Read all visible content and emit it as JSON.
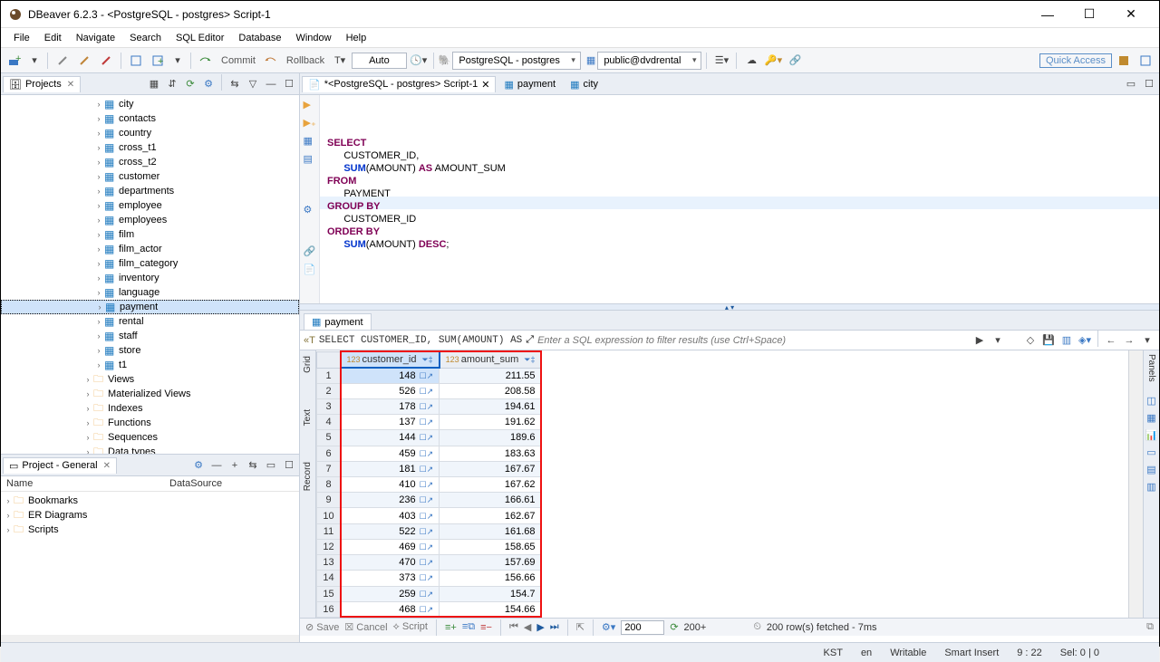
{
  "window": {
    "title": "DBeaver 6.2.3 - <PostgreSQL - postgres> Script-1"
  },
  "menu": [
    "File",
    "Edit",
    "Navigate",
    "Search",
    "SQL Editor",
    "Database",
    "Window",
    "Help"
  ],
  "toolbar": {
    "commit": "Commit",
    "rollback": "Rollback",
    "auto": "Auto",
    "connection": "PostgreSQL - postgres",
    "schema": "public@dvdrental",
    "quick_access": "Quick Access"
  },
  "projects": {
    "tab": "Projects",
    "tables": [
      "city",
      "contacts",
      "country",
      "cross_t1",
      "cross_t2",
      "customer",
      "departments",
      "employee",
      "employees",
      "film",
      "film_actor",
      "film_category",
      "inventory",
      "language",
      "payment",
      "rental",
      "staff",
      "store",
      "t1"
    ],
    "folders": [
      "Views",
      "Materialized Views",
      "Indexes",
      "Functions",
      "Sequences",
      "Data types"
    ],
    "selected": "payment"
  },
  "project_general": {
    "tab": "Project - General",
    "col_name": "Name",
    "col_ds": "DataSource",
    "items": [
      "Bookmarks",
      "ER Diagrams",
      "Scripts"
    ]
  },
  "editor": {
    "tabs": [
      {
        "label": "*<PostgreSQL - postgres> Script-1",
        "active": true
      },
      {
        "label": "payment",
        "active": false
      },
      {
        "label": "city",
        "active": false
      }
    ],
    "sql_lines": [
      {
        "kw": "SELECT",
        "rest": ""
      },
      {
        "kw": "",
        "rest": "      CUSTOMER_ID,"
      },
      {
        "kw": "",
        "rest": "      SUM(AMOUNT) AS AMOUNT_SUM"
      },
      {
        "kw": "FROM",
        "rest": ""
      },
      {
        "kw": "",
        "rest": "      PAYMENT"
      },
      {
        "kw": "GROUP BY",
        "rest": ""
      },
      {
        "kw": "",
        "rest": "      CUSTOMER_ID"
      },
      {
        "kw": "ORDER BY",
        "rest": ""
      },
      {
        "kw": "",
        "rest": "      SUM(AMOUNT) DESC;"
      }
    ]
  },
  "results": {
    "tab": "payment",
    "filter_static": "SELECT CUSTOMER_ID, SUM(AMOUNT) AS",
    "filter_placeholder": "Enter a SQL expression to filter results (use Ctrl+Space)",
    "side_grid": "Grid",
    "side_text": "Text",
    "side_record": "Record",
    "panels_label": "Panels",
    "col1": "customer_id",
    "col2": "amount_sum",
    "rows": [
      {
        "n": 1,
        "c": 148,
        "a": "211.55"
      },
      {
        "n": 2,
        "c": 526,
        "a": "208.58"
      },
      {
        "n": 3,
        "c": 178,
        "a": "194.61"
      },
      {
        "n": 4,
        "c": 137,
        "a": "191.62"
      },
      {
        "n": 5,
        "c": 144,
        "a": "189.6"
      },
      {
        "n": 6,
        "c": 459,
        "a": "183.63"
      },
      {
        "n": 7,
        "c": 181,
        "a": "167.67"
      },
      {
        "n": 8,
        "c": 410,
        "a": "167.62"
      },
      {
        "n": 9,
        "c": 236,
        "a": "166.61"
      },
      {
        "n": 10,
        "c": 403,
        "a": "162.67"
      },
      {
        "n": 11,
        "c": 522,
        "a": "161.68"
      },
      {
        "n": 12,
        "c": 469,
        "a": "158.65"
      },
      {
        "n": 13,
        "c": 470,
        "a": "157.69"
      },
      {
        "n": 14,
        "c": 373,
        "a": "156.66"
      },
      {
        "n": 15,
        "c": 259,
        "a": "154.7"
      },
      {
        "n": 16,
        "c": 468,
        "a": "154.66"
      }
    ],
    "footer": {
      "save": "Save",
      "cancel": "Cancel",
      "script": "Script",
      "page_size": "200",
      "rows_plus": "200+",
      "fetched": "200 row(s) fetched - 7ms"
    }
  },
  "status": {
    "kst": "KST",
    "lang": "en",
    "mode": "Writable",
    "insert": "Smart Insert",
    "pos": "9 : 22",
    "sel": "Sel: 0 | 0"
  }
}
